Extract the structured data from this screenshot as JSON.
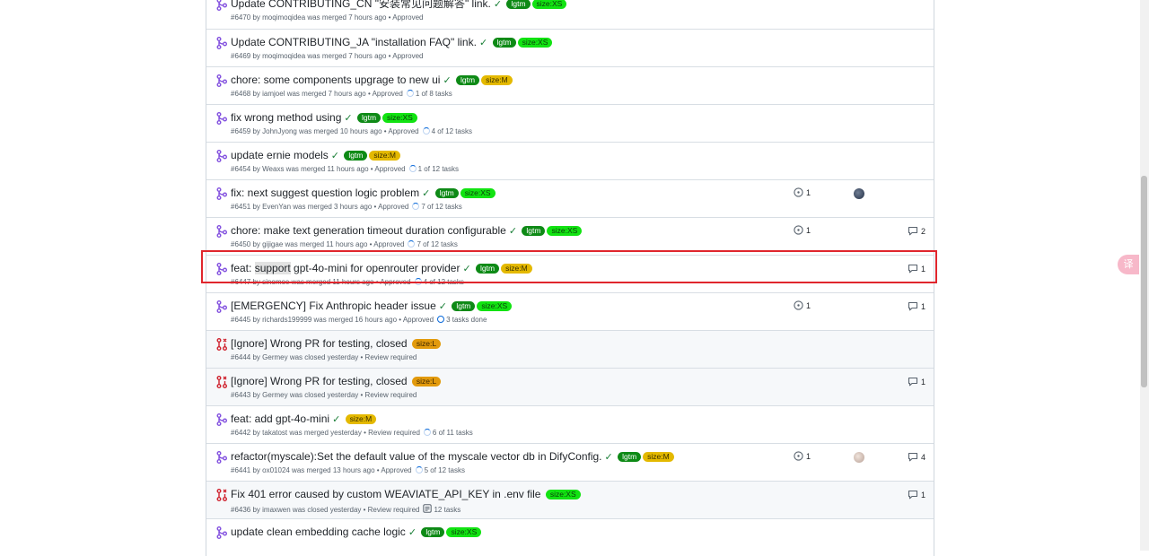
{
  "prs": [
    {
      "title": "Update CONTRIBUTING_CN \"安装常见问题解答\" link.",
      "status": "merged",
      "check": true,
      "labels": [
        {
          "text": "lgtm",
          "kind": "lgtm"
        },
        {
          "text": "size:XS",
          "kind": "xs"
        }
      ],
      "meta": "#6470 by moqimoqidea was merged 7 hours ago • Approved",
      "tasks": "",
      "task_kind": "",
      "linked": "",
      "avatar": "",
      "comments": ""
    },
    {
      "title": "Update CONTRIBUTING_JA \"installation FAQ\" link.",
      "status": "merged",
      "check": true,
      "labels": [
        {
          "text": "lgtm",
          "kind": "lgtm"
        },
        {
          "text": "size:XS",
          "kind": "xs"
        }
      ],
      "meta": "#6469 by moqimoqidea was merged 7 hours ago • Approved",
      "tasks": "",
      "task_kind": "",
      "linked": "",
      "avatar": "",
      "comments": ""
    },
    {
      "title": "chore: some components upgrage to new ui",
      "status": "merged",
      "check": true,
      "labels": [
        {
          "text": "lgtm",
          "kind": "lgtm"
        },
        {
          "text": "size:M",
          "kind": "m"
        }
      ],
      "meta": "#6468 by iamjoel was merged 7 hours ago • Approved",
      "tasks": "1 of 8 tasks",
      "task_kind": "ring",
      "linked": "",
      "avatar": "",
      "comments": ""
    },
    {
      "title": "fix wrong method using",
      "status": "merged",
      "check": true,
      "labels": [
        {
          "text": "lgtm",
          "kind": "lgtm"
        },
        {
          "text": "size:XS",
          "kind": "xs"
        }
      ],
      "meta": "#6459 by JohnJyong was merged 10 hours ago • Approved",
      "tasks": "4 of 12 tasks",
      "task_kind": "ring",
      "linked": "",
      "avatar": "",
      "comments": ""
    },
    {
      "title": "update ernie models",
      "status": "merged",
      "check": true,
      "labels": [
        {
          "text": "lgtm",
          "kind": "lgtm"
        },
        {
          "text": "size:M",
          "kind": "m"
        }
      ],
      "meta": "#6454 by Weaxs was merged 11 hours ago • Approved",
      "tasks": "1 of 12 tasks",
      "task_kind": "ring",
      "linked": "",
      "avatar": "",
      "comments": ""
    },
    {
      "title": "fix: next suggest question logic problem",
      "status": "merged",
      "check": true,
      "labels": [
        {
          "text": "lgtm",
          "kind": "lgtm"
        },
        {
          "text": "size:XS",
          "kind": "xs"
        }
      ],
      "meta": "#6451 by EvenYan was merged 3 hours ago • Approved",
      "tasks": "7 of 12 tasks",
      "task_kind": "ring",
      "linked": "1",
      "avatar": "dark",
      "comments": ""
    },
    {
      "title": "chore: make text generation timeout duration configurable",
      "status": "merged",
      "check": true,
      "labels": [
        {
          "text": "lgtm",
          "kind": "lgtm"
        },
        {
          "text": "size:XS",
          "kind": "xs"
        }
      ],
      "meta": "#6450 by gijigae was merged 11 hours ago • Approved",
      "tasks": "7 of 12 tasks",
      "task_kind": "ring",
      "linked": "1",
      "avatar": "",
      "comments": "2"
    },
    {
      "title_pre": "feat: ",
      "title_mark": "support",
      "title_post": " gpt-4o-mini for openrouter provider",
      "title": "",
      "highlight": true,
      "status": "merged",
      "check": true,
      "labels": [
        {
          "text": "lgtm",
          "kind": "lgtm"
        },
        {
          "text": "size:M",
          "kind": "m"
        }
      ],
      "meta": "#6447 by sinomoe was merged 11 hours ago • Approved",
      "tasks": "4 of 12 tasks",
      "task_kind": "ring",
      "linked": "",
      "avatar": "",
      "comments": "1"
    },
    {
      "title": "[EMERGENCY] Fix Anthropic header issue",
      "status": "merged",
      "check": true,
      "labels": [
        {
          "text": "lgtm",
          "kind": "lgtm"
        },
        {
          "text": "size:XS",
          "kind": "xs"
        }
      ],
      "meta": "#6445 by richards199999 was merged 16 hours ago • Approved",
      "tasks": "3 tasks done",
      "task_kind": "done",
      "linked": "1",
      "avatar": "",
      "comments": "1"
    },
    {
      "title": "[Ignore] Wrong PR for testing, closed",
      "status": "closed",
      "check": false,
      "labels": [
        {
          "text": "size:L",
          "kind": "l"
        }
      ],
      "meta": "#6444 by Germey was closed yesterday • Review required",
      "tasks": "",
      "task_kind": "",
      "linked": "",
      "avatar": "",
      "comments": ""
    },
    {
      "title": "[Ignore] Wrong PR for testing, closed",
      "status": "closed",
      "check": false,
      "labels": [
        {
          "text": "size:L",
          "kind": "l"
        }
      ],
      "meta": "#6443 by Germey was closed yesterday • Review required",
      "tasks": "",
      "task_kind": "",
      "linked": "",
      "avatar": "",
      "comments": "1"
    },
    {
      "title": "feat: add gpt-4o-mini",
      "status": "merged",
      "check": true,
      "labels": [
        {
          "text": "size:M",
          "kind": "m"
        }
      ],
      "meta": "#6442 by takatost was merged yesterday • Review required",
      "tasks": "6 of 11 tasks",
      "task_kind": "ring",
      "linked": "",
      "avatar": "",
      "comments": ""
    },
    {
      "title": "refactor(myscale):Set the default value of the myscale vector db in DifyConfig.",
      "status": "merged",
      "check": true,
      "labels": [
        {
          "text": "lgtm",
          "kind": "lgtm"
        },
        {
          "text": "size:M",
          "kind": "m"
        }
      ],
      "meta": "#6441 by ox01024 was merged 13 hours ago • Approved",
      "tasks": "5 of 12 tasks",
      "task_kind": "ring",
      "linked": "1",
      "avatar": "light",
      "comments": "4"
    },
    {
      "title": "Fix 401 error caused by custom WEAVIATE_API_KEY in .env file",
      "status": "closed",
      "check": false,
      "labels": [
        {
          "text": "size:XS",
          "kind": "xs"
        }
      ],
      "meta": "#6436 by imaxwen was closed yesterday • Review required",
      "tasks": "12 tasks",
      "task_kind": "list",
      "linked": "",
      "avatar": "",
      "comments": "1"
    },
    {
      "title": "update clean embedding cache logic",
      "status": "merged",
      "check": true,
      "labels": [
        {
          "text": "lgtm",
          "kind": "lgtm"
        },
        {
          "text": "size:XS",
          "kind": "xs"
        }
      ],
      "meta": "",
      "tasks": "",
      "task_kind": "",
      "linked": "",
      "avatar": "",
      "comments": ""
    }
  ],
  "icons": {
    "merged": "git-merge-icon",
    "closed": "git-pull-request-closed-icon",
    "linked": "issue-opened-icon",
    "comments": "comment-icon",
    "check": "check-icon"
  },
  "colors": {
    "merged": "#8250df",
    "closed": "#cf222e",
    "highlight_border": "#e0262d"
  },
  "translate_button": "译"
}
